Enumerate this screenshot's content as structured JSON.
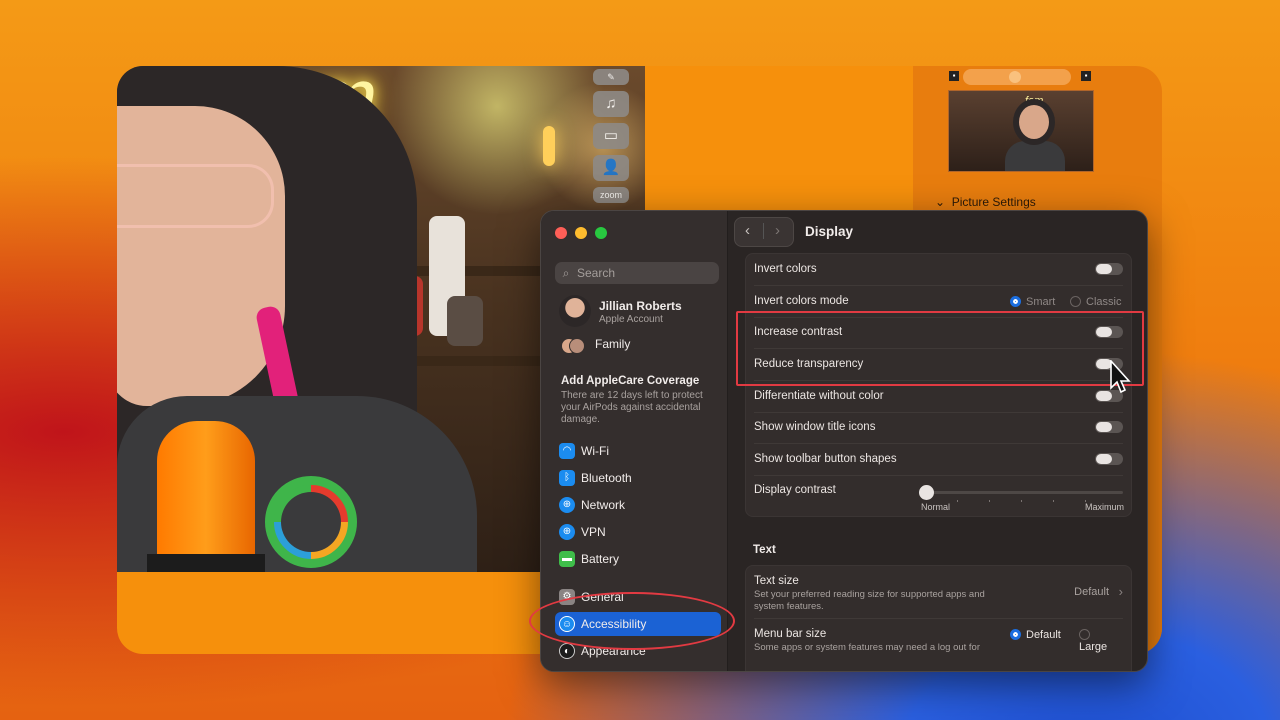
{
  "toolstrip": {
    "zoom_label": "zoom"
  },
  "right_panel": {
    "picture_settings": "Picture Settings"
  },
  "sidebar": {
    "search_placeholder": "Search",
    "account_name": "Jillian Roberts",
    "account_sub": "Apple Account",
    "family": "Family",
    "applecare_title": "Add AppleCare Coverage",
    "applecare_body": "There are 12 days left to protect your AirPods against accidental damage.",
    "items": [
      {
        "label": "Wi-Fi",
        "icon": "wifi-icon",
        "color": "#1b8cf0"
      },
      {
        "label": "Bluetooth",
        "icon": "bluetooth-icon",
        "color": "#1b8cf0"
      },
      {
        "label": "Network",
        "icon": "globe-icon",
        "color": "#1b8cf0"
      },
      {
        "label": "VPN",
        "icon": "vpn-globe-icon",
        "color": "#1b8cf0"
      },
      {
        "label": "Battery",
        "icon": "battery-icon",
        "color": "#3fbe4a"
      },
      {
        "label": "General",
        "icon": "gear-icon",
        "color": "#8a8483"
      },
      {
        "label": "Accessibility",
        "icon": "accessibility-icon",
        "color": "#1b8cf0",
        "selected": true
      },
      {
        "label": "Appearance",
        "icon": "appearance-icon",
        "color": "#1c1c1c"
      }
    ]
  },
  "main": {
    "title": "Display",
    "rows": {
      "invert_colors": "Invert colors",
      "invert_mode": "Invert colors mode",
      "invert_mode_smart": "Smart",
      "invert_mode_classic": "Classic",
      "increase_contrast": "Increase contrast",
      "reduce_transparency": "Reduce transparency",
      "differentiate": "Differentiate without color",
      "title_icons": "Show window title icons",
      "toolbar_shapes": "Show toolbar button shapes",
      "display_contrast": "Display contrast",
      "contrast_min": "Normal",
      "contrast_max": "Maximum"
    },
    "text_section": "Text",
    "text_size": "Text size",
    "text_size_sub": "Set your preferred reading size for supported apps and system features.",
    "text_size_value": "Default",
    "menu_bar_size": "Menu bar size",
    "menu_bar_sub": "Some apps or system features may need a log out for",
    "menu_default": "Default",
    "menu_large": "Large"
  },
  "colors": {
    "accent": "#1b62d4",
    "annotation": "#e23a42"
  }
}
